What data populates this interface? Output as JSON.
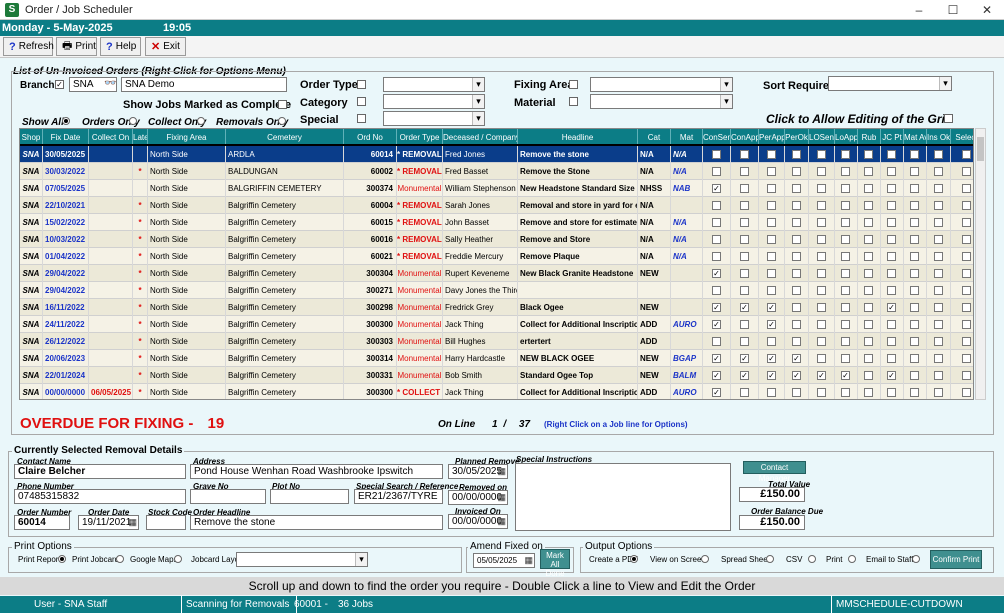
{
  "window": {
    "title": "Order / Job Scheduler",
    "app_icon": "S",
    "minimize": "–",
    "maximize": "☐",
    "close": "✕"
  },
  "datebar": {
    "date": "Monday - 5-May-2025",
    "time": "19:05"
  },
  "toolbar": {
    "refresh": "Refresh",
    "print": "Print",
    "help": "Help",
    "exit": "Exit"
  },
  "filters": {
    "section_title": "List of Un-Invoiced Orders (Right Click for Options Menu)",
    "branch_label": "Branch",
    "branch_code": "SNA",
    "branch_name": "SNA Demo",
    "order_type_label": "Order Type",
    "category_label": "Category",
    "special_label": "Special",
    "fixing_area_label": "Fixing Area",
    "material_label": "Material",
    "sort_label": "Sort Required",
    "show_complete_label": "Show Jobs Marked as Complete",
    "show_all": "Show All",
    "orders_only": "Orders Only",
    "collect_only": "Collect Only",
    "removals_only": "Removals Only",
    "allow_edit": "Click to Allow Editing of the Grid"
  },
  "grid": {
    "columns": [
      "Shop",
      "Fix Date",
      "Collect On",
      "Late",
      "Fixing Area",
      "Cemetery",
      "Ord No",
      "Order Type",
      "Deceased / Company",
      "Headline",
      "Cat",
      "Mat",
      "ConSent",
      "ConApp",
      "PerApp",
      "PerOk",
      "LOSent",
      "LoApp",
      "Rub",
      "JC Pt",
      "Mat Av",
      "Ins Ok",
      "Select"
    ],
    "rows": [
      {
        "shop": "SNA",
        "fix": "30/05/2025",
        "collect": "",
        "late": "",
        "area": "North Side",
        "cem": "ARDLA",
        "ord": "60014",
        "type": "* REMOVAL *",
        "dec": "Fred Jones",
        "head": "Remove the stone",
        "cat": "N/A",
        "mat": "N/A",
        "checks": [
          0,
          0,
          0,
          0,
          0,
          0,
          0,
          0,
          0,
          0,
          0
        ]
      },
      {
        "shop": "SNA",
        "fix": "30/03/2022",
        "collect": "",
        "late": "*",
        "area": "North Side",
        "cem": "BALDUNGAN",
        "ord": "60002",
        "type": "* REMOVAL *",
        "dec": "Fred Basset",
        "head": "Remove the Stone",
        "cat": "N/A",
        "mat": "N/A",
        "checks": [
          0,
          0,
          0,
          0,
          0,
          0,
          0,
          0,
          0,
          0,
          0
        ]
      },
      {
        "shop": "SNA",
        "fix": "07/05/2025",
        "collect": "",
        "late": "",
        "area": "North Side",
        "cem": "BALGRIFFIN CEMETERY",
        "ord": "300374",
        "type": "Monumental",
        "dec": "William Stephenson",
        "head": "New Headstone Standard Size",
        "cat": "NHSS",
        "mat": "NAB",
        "checks": [
          1,
          0,
          0,
          0,
          0,
          0,
          0,
          0,
          0,
          0,
          0
        ]
      },
      {
        "shop": "SNA",
        "fix": "22/10/2021",
        "collect": "",
        "late": "*",
        "area": "North Side",
        "cem": "Balgriffin Cemetery",
        "ord": "60004",
        "type": "* REMOVAL *",
        "dec": "Sarah Jones",
        "head": "Removal and store in yard for estimat",
        "cat": "N/A",
        "mat": "",
        "checks": [
          0,
          0,
          0,
          0,
          0,
          0,
          0,
          0,
          0,
          0,
          0
        ]
      },
      {
        "shop": "SNA",
        "fix": "15/02/2022",
        "collect": "",
        "late": "*",
        "area": "North Side",
        "cem": "Balgriffin Cemetery",
        "ord": "60015",
        "type": "* REMOVAL *",
        "dec": "John Basset",
        "head": "Remove and store for estimate",
        "cat": "N/A",
        "mat": "N/A",
        "checks": [
          0,
          0,
          0,
          0,
          0,
          0,
          0,
          0,
          0,
          0,
          0
        ]
      },
      {
        "shop": "SNA",
        "fix": "10/03/2022",
        "collect": "",
        "late": "*",
        "area": "North Side",
        "cem": "Balgriffin Cemetery",
        "ord": "60016",
        "type": "* REMOVAL *",
        "dec": "Sally Heather",
        "head": "Remove and Store",
        "cat": "N/A",
        "mat": "N/A",
        "checks": [
          0,
          0,
          0,
          0,
          0,
          0,
          0,
          0,
          0,
          0,
          0
        ]
      },
      {
        "shop": "SNA",
        "fix": "01/04/2022",
        "collect": "",
        "late": "*",
        "area": "North Side",
        "cem": "Balgriffin Cemetery",
        "ord": "60021",
        "type": "* REMOVAL *",
        "dec": "Freddie Mercury",
        "head": "Remove Plaque",
        "cat": "N/A",
        "mat": "N/A",
        "checks": [
          0,
          0,
          0,
          0,
          0,
          0,
          0,
          0,
          0,
          0,
          0
        ]
      },
      {
        "shop": "SNA",
        "fix": "29/04/2022",
        "collect": "",
        "late": "*",
        "area": "North Side",
        "cem": "Balgriffin Cemetery",
        "ord": "300304",
        "type": "Monumental",
        "dec": "Rupert Keveneme",
        "head": "New Black Granite Headstone",
        "cat": "NEW",
        "mat": "",
        "checks": [
          1,
          0,
          0,
          0,
          0,
          0,
          0,
          0,
          0,
          0,
          0
        ]
      },
      {
        "shop": "SNA",
        "fix": "29/04/2022",
        "collect": "",
        "late": "*",
        "area": "North Side",
        "cem": "Balgriffin Cemetery",
        "ord": "300271",
        "type": "Monumental",
        "dec": "Davy Jones the Third",
        "head": "",
        "cat": "",
        "mat": "",
        "checks": [
          0,
          0,
          0,
          0,
          0,
          0,
          0,
          0,
          0,
          0,
          0
        ]
      },
      {
        "shop": "SNA",
        "fix": "16/11/2022",
        "collect": "",
        "late": "*",
        "area": "North Side",
        "cem": "Balgriffin Cemetery",
        "ord": "300298",
        "type": "Monumental",
        "dec": "Fredrick Grey",
        "head": "Black Ogee",
        "cat": "NEW",
        "mat": "",
        "checks": [
          1,
          1,
          1,
          0,
          0,
          0,
          0,
          1,
          0,
          0,
          0
        ]
      },
      {
        "shop": "SNA",
        "fix": "24/11/2022",
        "collect": "",
        "late": "*",
        "area": "North Side",
        "cem": "Balgriffin Cemetery",
        "ord": "300300",
        "type": "Monumental",
        "dec": "Jack Thing",
        "head": "Collect for Additional Inscription",
        "cat": "ADD",
        "mat": "AURO",
        "checks": [
          1,
          0,
          1,
          0,
          0,
          0,
          0,
          0,
          0,
          0,
          0
        ]
      },
      {
        "shop": "SNA",
        "fix": "26/12/2022",
        "collect": "",
        "late": "*",
        "area": "North Side",
        "cem": "Balgriffin Cemetery",
        "ord": "300303",
        "type": "Monumental",
        "dec": "Bill Hughes",
        "head": "ertertert",
        "cat": "ADD",
        "mat": "",
        "checks": [
          0,
          0,
          0,
          0,
          0,
          0,
          0,
          0,
          0,
          0,
          0
        ]
      },
      {
        "shop": "SNA",
        "fix": "20/06/2023",
        "collect": "",
        "late": "*",
        "area": "North Side",
        "cem": "Balgriffin Cemetery",
        "ord": "300314",
        "type": "Monumental",
        "dec": "Harry Hardcastle",
        "head": "NEW BLACK OGEE",
        "cat": "NEW",
        "mat": "BGAP",
        "checks": [
          1,
          1,
          1,
          1,
          0,
          0,
          0,
          0,
          0,
          0,
          0
        ]
      },
      {
        "shop": "SNA",
        "fix": "22/01/2024",
        "collect": "",
        "late": "*",
        "area": "North Side",
        "cem": "Balgriffin Cemetery",
        "ord": "300331",
        "type": "Monumental",
        "dec": "Bob Smith",
        "head": "Standard Ogee Top",
        "cat": "NEW",
        "mat": "BALM",
        "checks": [
          1,
          1,
          1,
          1,
          1,
          1,
          0,
          1,
          0,
          0,
          0
        ]
      },
      {
        "shop": "SNA",
        "fix": "00/00/0000",
        "collect": "06/05/2025",
        "late": "*",
        "area": "North Side",
        "cem": "Balgriffin Cemetery",
        "ord": "300300",
        "type": "* COLLECT *",
        "dec": "Jack Thing",
        "head": "Collect for Additional Inscription",
        "cat": "ADD",
        "mat": "AURO",
        "checks": [
          1,
          0,
          0,
          0,
          0,
          0,
          0,
          0,
          0,
          0,
          0
        ]
      }
    ]
  },
  "summary": {
    "overdue": "OVERDUE FOR FIXING -",
    "overdue_count": "19",
    "online_label": "On Line",
    "line_num": "1",
    "line_sep": "/",
    "line_total": "37",
    "rightclick_hint": "(Right Click on a Job line for Options)"
  },
  "details": {
    "title": "Currently Selected Removal Details",
    "contact_name_label": "Contact Name",
    "contact_name": "Claire Belcher",
    "address_label": "Address",
    "address": "Pond House Wenhan Road Washbrooke Ipswitch",
    "planned_remove_label": "Planned Remove",
    "planned_remove": "30/05/2025",
    "special_instr_label": "Special Instructions",
    "contact_manager": "Contact Manager",
    "phone_label": "Phone Number",
    "phone": "07485315832",
    "grave_label": "Grave No",
    "grave": "",
    "plot_label": "Plot No",
    "plot": "",
    "search_ref_label": "Special Search / Reference",
    "search_ref": "ER21/2367/TYRE",
    "removed_on_label": "Removed on",
    "removed_on": "00/00/0000",
    "total_value_label": "Total Value",
    "total_value": "£150.00",
    "order_number_label": "Order Number",
    "order_number": "60014",
    "order_date_label": "Order Date",
    "order_date": "19/11/2021",
    "stock_code_label": "Stock Code",
    "stock_code": "",
    "order_headline_label": "Order Headline",
    "order_headline": "Remove the stone",
    "invoiced_on_label": "Invoiced On",
    "invoiced_on": "00/00/0000",
    "balance_label": "Order Balance Due",
    "balance": "£150.00"
  },
  "print_options": {
    "title": "Print Options",
    "print_report": "Print Report",
    "print_jobcard": "Print Jobcard",
    "google_maps": "Google Maps",
    "jobcard_layout": "Jobcard Layout"
  },
  "amend": {
    "title": "Amend Fixed on",
    "date": "05/05/2025",
    "mark_all_line1": "Mark All",
    "mark_all_line2": "Done"
  },
  "output_options": {
    "title": "Output Options",
    "pdf": "Create a PDF",
    "screen": "View on Screen",
    "sheet": "Spread Sheet",
    "csv": "CSV",
    "print": "Print",
    "email": "Email to Staff",
    "confirm": "Confirm Print"
  },
  "status_message": "Scroll up and down to find the order you require - Double Click a line to View and Edit the Order",
  "statusbar": {
    "user": "User - SNA Staff",
    "scan": "Scanning for Removals",
    "scan_num": "60001 -",
    "scan_jobs": "36 Jobs",
    "module": "MMSCHEDULE-CUTDOWN"
  }
}
